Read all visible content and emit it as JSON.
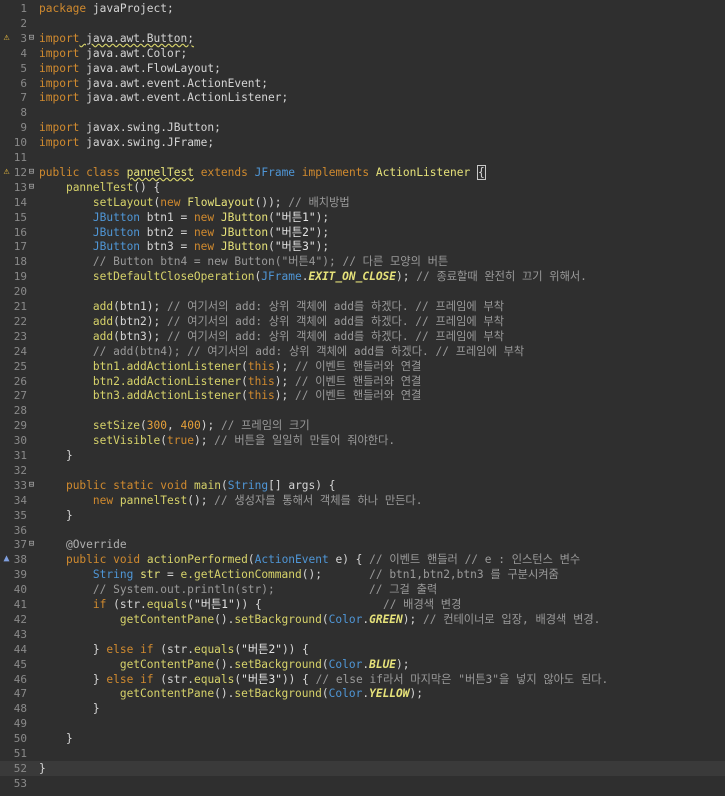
{
  "editor": {
    "current_line": 52,
    "colors": {
      "background": "#2f2f2f",
      "keyword": "#d08a2f",
      "type": "#4f96d6",
      "comment": "#9a9a9a",
      "string": "#e6e6e6",
      "number": "#e8a23a",
      "constant": "#e6e27a"
    },
    "lines": [
      {
        "n": "1",
        "tokens": [
          [
            "kw",
            "package"
          ],
          [
            "plain",
            " javaProject;"
          ]
        ]
      },
      {
        "n": "2",
        "tokens": []
      },
      {
        "n": "3",
        "fold": true,
        "marker": "warn",
        "tokens": [
          [
            "kw",
            "import"
          ],
          [
            "plain",
            " java.awt.Button;",
            "sq"
          ]
        ]
      },
      {
        "n": "4",
        "tokens": [
          [
            "kw",
            "import"
          ],
          [
            "plain",
            " java.awt.Color;"
          ]
        ]
      },
      {
        "n": "5",
        "tokens": [
          [
            "kw",
            "import"
          ],
          [
            "plain",
            " java.awt.FlowLayout;"
          ]
        ]
      },
      {
        "n": "6",
        "tokens": [
          [
            "kw",
            "import"
          ],
          [
            "plain",
            " java.awt.event.ActionEvent;"
          ]
        ]
      },
      {
        "n": "7",
        "tokens": [
          [
            "kw",
            "import"
          ],
          [
            "plain",
            " java.awt.event.ActionListener;"
          ]
        ]
      },
      {
        "n": "8",
        "tokens": []
      },
      {
        "n": "9",
        "tokens": [
          [
            "kw",
            "import"
          ],
          [
            "plain",
            " javax.swing.JButton;"
          ]
        ]
      },
      {
        "n": "10",
        "tokens": [
          [
            "kw",
            "import"
          ],
          [
            "plain",
            " javax.swing.JFrame;"
          ]
        ]
      },
      {
        "n": "11",
        "tokens": []
      },
      {
        "n": "12",
        "fold": true,
        "marker": "warn",
        "tokens": [
          [
            "kw",
            "public"
          ],
          [
            "plain",
            " "
          ],
          [
            "kw",
            "class"
          ],
          [
            "plain",
            " "
          ],
          [
            "cls",
            "pannelTest",
            "sq"
          ],
          [
            "plain",
            " "
          ],
          [
            "kw",
            "extends"
          ],
          [
            "plain",
            " "
          ],
          [
            "type",
            "JFrame"
          ],
          [
            "plain",
            " "
          ],
          [
            "kw",
            "implements"
          ],
          [
            "plain",
            " "
          ],
          [
            "cls",
            "ActionListener"
          ],
          [
            "plain",
            " "
          ],
          [
            "plain",
            "{",
            "caret"
          ]
        ]
      },
      {
        "n": "13",
        "fold": true,
        "tokens": [
          [
            "plain",
            "    "
          ],
          [
            "fn",
            "pannelTest"
          ],
          [
            "plain",
            "() {"
          ]
        ]
      },
      {
        "n": "14",
        "tokens": [
          [
            "plain",
            "        "
          ],
          [
            "fn",
            "setLayout"
          ],
          [
            "plain",
            "("
          ],
          [
            "kw",
            "new"
          ],
          [
            "plain",
            " "
          ],
          [
            "cls",
            "FlowLayout"
          ],
          [
            "plain",
            "()); "
          ],
          [
            "com",
            "// 배치방법"
          ]
        ]
      },
      {
        "n": "15",
        "tokens": [
          [
            "plain",
            "        "
          ],
          [
            "type",
            "JButton"
          ],
          [
            "plain",
            " btn1 = "
          ],
          [
            "kw",
            "new"
          ],
          [
            "plain",
            " "
          ],
          [
            "cls",
            "JButton"
          ],
          [
            "plain",
            "("
          ],
          [
            "str",
            "\"버튼1\""
          ],
          [
            "plain",
            ");"
          ]
        ]
      },
      {
        "n": "16",
        "tokens": [
          [
            "plain",
            "        "
          ],
          [
            "type",
            "JButton"
          ],
          [
            "plain",
            " btn2 = "
          ],
          [
            "kw",
            "new"
          ],
          [
            "plain",
            " "
          ],
          [
            "cls",
            "JButton"
          ],
          [
            "plain",
            "("
          ],
          [
            "str",
            "\"버튼2\""
          ],
          [
            "plain",
            ");"
          ]
        ]
      },
      {
        "n": "17",
        "tokens": [
          [
            "plain",
            "        "
          ],
          [
            "type",
            "JButton"
          ],
          [
            "plain",
            " btn3 = "
          ],
          [
            "kw",
            "new"
          ],
          [
            "plain",
            " "
          ],
          [
            "cls",
            "JButton"
          ],
          [
            "plain",
            "("
          ],
          [
            "str",
            "\"버튼3\""
          ],
          [
            "plain",
            ");"
          ]
        ]
      },
      {
        "n": "18",
        "tokens": [
          [
            "plain",
            "        "
          ],
          [
            "com",
            "// Button btn4 = new Button(\"버튼4\"); // 다른 모양의 버튼"
          ]
        ]
      },
      {
        "n": "19",
        "tokens": [
          [
            "plain",
            "        "
          ],
          [
            "fn",
            "setDefaultCloseOperation"
          ],
          [
            "plain",
            "("
          ],
          [
            "type",
            "JFrame"
          ],
          [
            "plain",
            "."
          ],
          [
            "cst",
            "EXIT_ON_CLOSE"
          ],
          [
            "plain",
            "); "
          ],
          [
            "com",
            "// 종료할때 완전히 끄기 위해서."
          ]
        ]
      },
      {
        "n": "20",
        "tokens": []
      },
      {
        "n": "21",
        "tokens": [
          [
            "plain",
            "        "
          ],
          [
            "fn",
            "add"
          ],
          [
            "plain",
            "(btn1); "
          ],
          [
            "com",
            "// 여기서의 add: 상위 객체에 add를 하겠다. // 프레임에 부착"
          ]
        ]
      },
      {
        "n": "22",
        "tokens": [
          [
            "plain",
            "        "
          ],
          [
            "fn",
            "add"
          ],
          [
            "plain",
            "(btn2); "
          ],
          [
            "com",
            "// 여기서의 add: 상위 객체에 add를 하겠다. // 프레임에 부착"
          ]
        ]
      },
      {
        "n": "23",
        "tokens": [
          [
            "plain",
            "        "
          ],
          [
            "fn",
            "add"
          ],
          [
            "plain",
            "(btn3); "
          ],
          [
            "com",
            "// 여기서의 add: 상위 객체에 add를 하겠다. // 프레임에 부착"
          ]
        ]
      },
      {
        "n": "24",
        "tokens": [
          [
            "plain",
            "        "
          ],
          [
            "com",
            "// add(btn4); // 여기서의 add: 상위 객체에 add를 하겠다. // 프레임에 부착"
          ]
        ]
      },
      {
        "n": "25",
        "tokens": [
          [
            "plain",
            "        "
          ],
          [
            "fn",
            "btn1.addActionListener"
          ],
          [
            "plain",
            "("
          ],
          [
            "kw",
            "this"
          ],
          [
            "plain",
            "); "
          ],
          [
            "com",
            "// 이벤트 핸들러와 연결"
          ]
        ]
      },
      {
        "n": "26",
        "tokens": [
          [
            "plain",
            "        "
          ],
          [
            "fn",
            "btn2.addActionListener"
          ],
          [
            "plain",
            "("
          ],
          [
            "kw",
            "this"
          ],
          [
            "plain",
            "); "
          ],
          [
            "com",
            "// 이벤트 핸들러와 연결"
          ]
        ]
      },
      {
        "n": "27",
        "tokens": [
          [
            "plain",
            "        "
          ],
          [
            "fn",
            "btn3.addActionListener"
          ],
          [
            "plain",
            "("
          ],
          [
            "kw",
            "this"
          ],
          [
            "plain",
            "); "
          ],
          [
            "com",
            "// 이벤트 핸들러와 연결"
          ]
        ]
      },
      {
        "n": "28",
        "tokens": []
      },
      {
        "n": "29",
        "tokens": [
          [
            "plain",
            "        "
          ],
          [
            "fn",
            "setSize"
          ],
          [
            "plain",
            "("
          ],
          [
            "num",
            "300"
          ],
          [
            "plain",
            ", "
          ],
          [
            "num",
            "400"
          ],
          [
            "plain",
            "); "
          ],
          [
            "com",
            "// 프레임의 크기"
          ]
        ]
      },
      {
        "n": "30",
        "tokens": [
          [
            "plain",
            "        "
          ],
          [
            "fn",
            "setVisible"
          ],
          [
            "plain",
            "("
          ],
          [
            "kw",
            "true"
          ],
          [
            "plain",
            "); "
          ],
          [
            "com",
            "// 버튼을 일일히 만들어 줘야한다."
          ]
        ]
      },
      {
        "n": "31",
        "tokens": [
          [
            "plain",
            "    }"
          ]
        ]
      },
      {
        "n": "32",
        "tokens": []
      },
      {
        "n": "33",
        "fold": true,
        "tokens": [
          [
            "plain",
            "    "
          ],
          [
            "kw",
            "public"
          ],
          [
            "plain",
            " "
          ],
          [
            "kw",
            "static"
          ],
          [
            "plain",
            " "
          ],
          [
            "kw",
            "void"
          ],
          [
            "plain",
            " "
          ],
          [
            "fn",
            "main"
          ],
          [
            "plain",
            "("
          ],
          [
            "type",
            "String"
          ],
          [
            "plain",
            "[] args) {"
          ]
        ]
      },
      {
        "n": "34",
        "tokens": [
          [
            "plain",
            "        "
          ],
          [
            "kw",
            "new"
          ],
          [
            "plain",
            " "
          ],
          [
            "fn",
            "pannelTest"
          ],
          [
            "plain",
            "(); "
          ],
          [
            "com",
            "// 생성자를 통해서 객체를 하나 만든다."
          ]
        ]
      },
      {
        "n": "35",
        "tokens": [
          [
            "plain",
            "    }"
          ]
        ]
      },
      {
        "n": "36",
        "tokens": []
      },
      {
        "n": "37",
        "fold": true,
        "tokens": [
          [
            "plain",
            "    "
          ],
          [
            "ann",
            "@Override"
          ]
        ]
      },
      {
        "n": "38",
        "marker": "override",
        "tokens": [
          [
            "plain",
            "    "
          ],
          [
            "kw",
            "public"
          ],
          [
            "plain",
            " "
          ],
          [
            "kw",
            "void"
          ],
          [
            "plain",
            " "
          ],
          [
            "fn",
            "actionPerformed"
          ],
          [
            "plain",
            "("
          ],
          [
            "type",
            "ActionEvent"
          ],
          [
            "plain",
            " e) { "
          ],
          [
            "com",
            "// 이벤트 핸들러 // e : 인스턴스 변수"
          ]
        ]
      },
      {
        "n": "39",
        "tokens": [
          [
            "plain",
            "        "
          ],
          [
            "type",
            "String"
          ],
          [
            "plain",
            " "
          ],
          [
            "cls",
            "str"
          ],
          [
            "plain",
            " = "
          ],
          [
            "fn",
            "e.getActionCommand"
          ],
          [
            "plain",
            "();       "
          ],
          [
            "com",
            "// btn1,btn2,btn3 를 구분시켜줌"
          ]
        ]
      },
      {
        "n": "40",
        "tokens": [
          [
            "plain",
            "        "
          ],
          [
            "com",
            "// System.out.println(str);              // 그걸 출력"
          ]
        ]
      },
      {
        "n": "41",
        "tokens": [
          [
            "plain",
            "        "
          ],
          [
            "kw",
            "if"
          ],
          [
            "plain",
            " (str."
          ],
          [
            "fn",
            "equals"
          ],
          [
            "plain",
            "("
          ],
          [
            "str",
            "\"버튼1\""
          ],
          [
            "plain",
            ")) {                  "
          ],
          [
            "com",
            "// 배경색 변경"
          ]
        ]
      },
      {
        "n": "42",
        "tokens": [
          [
            "plain",
            "            "
          ],
          [
            "fn",
            "getContentPane"
          ],
          [
            "plain",
            "()."
          ],
          [
            "fn",
            "setBackground"
          ],
          [
            "plain",
            "("
          ],
          [
            "type",
            "Color"
          ],
          [
            "plain",
            "."
          ],
          [
            "cst",
            "GREEN"
          ],
          [
            "plain",
            "); "
          ],
          [
            "com",
            "// 컨테이너로 입장, 배경색 변경."
          ]
        ]
      },
      {
        "n": "43",
        "tokens": []
      },
      {
        "n": "44",
        "tokens": [
          [
            "plain",
            "        } "
          ],
          [
            "kw",
            "else"
          ],
          [
            "plain",
            " "
          ],
          [
            "kw",
            "if"
          ],
          [
            "plain",
            " (str."
          ],
          [
            "fn",
            "equals"
          ],
          [
            "plain",
            "("
          ],
          [
            "str",
            "\"버튼2\""
          ],
          [
            "plain",
            ")) {"
          ]
        ]
      },
      {
        "n": "45",
        "tokens": [
          [
            "plain",
            "            "
          ],
          [
            "fn",
            "getContentPane"
          ],
          [
            "plain",
            "()."
          ],
          [
            "fn",
            "setBackground"
          ],
          [
            "plain",
            "("
          ],
          [
            "type",
            "Color"
          ],
          [
            "plain",
            "."
          ],
          [
            "cst",
            "BLUE"
          ],
          [
            "plain",
            ");"
          ]
        ]
      },
      {
        "n": "46",
        "tokens": [
          [
            "plain",
            "        } "
          ],
          [
            "kw",
            "else"
          ],
          [
            "plain",
            " "
          ],
          [
            "kw",
            "if"
          ],
          [
            "plain",
            " (str."
          ],
          [
            "fn",
            "equals"
          ],
          [
            "plain",
            "("
          ],
          [
            "str",
            "\"버튼3\""
          ],
          [
            "plain",
            ")) { "
          ],
          [
            "com",
            "// else if라서 마지막은 \"버튼3\"을 넣지 않아도 된다."
          ]
        ]
      },
      {
        "n": "47",
        "tokens": [
          [
            "plain",
            "            "
          ],
          [
            "fn",
            "getContentPane"
          ],
          [
            "plain",
            "()."
          ],
          [
            "fn",
            "setBackground"
          ],
          [
            "plain",
            "("
          ],
          [
            "type",
            "Color"
          ],
          [
            "plain",
            "."
          ],
          [
            "cst",
            "YELLOW"
          ],
          [
            "plain",
            ");"
          ]
        ]
      },
      {
        "n": "48",
        "tokens": [
          [
            "plain",
            "        }"
          ]
        ]
      },
      {
        "n": "49",
        "tokens": []
      },
      {
        "n": "50",
        "tokens": [
          [
            "plain",
            "    }"
          ]
        ]
      },
      {
        "n": "51",
        "tokens": []
      },
      {
        "n": "52",
        "tokens": [
          [
            "plain",
            "}"
          ]
        ]
      },
      {
        "n": "53",
        "tokens": []
      }
    ]
  }
}
